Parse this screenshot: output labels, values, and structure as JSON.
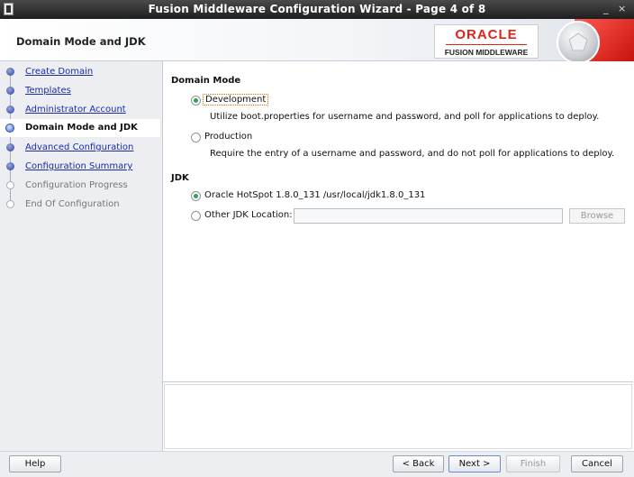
{
  "window": {
    "title": "Fusion Middleware Configuration Wizard - Page 4 of 8",
    "minimize_glyph": "_",
    "close_glyph": "×"
  },
  "header": {
    "step_title": "Domain Mode and JDK",
    "oracle_word": "ORACLE",
    "oracle_sub": "FUSION MIDDLEWARE"
  },
  "steps": [
    {
      "label": "Create Domain",
      "state": "done"
    },
    {
      "label": "Templates",
      "state": "done"
    },
    {
      "label": "Administrator Account",
      "state": "done"
    },
    {
      "label": "Domain Mode and JDK",
      "state": "current"
    },
    {
      "label": "Advanced Configuration",
      "state": "done"
    },
    {
      "label": "Configuration Summary",
      "state": "done"
    },
    {
      "label": "Configuration Progress",
      "state": "todo"
    },
    {
      "label": "End Of Configuration",
      "state": "todo"
    }
  ],
  "domain_mode": {
    "heading": "Domain Mode",
    "development": {
      "label": "Development",
      "description": "Utilize boot.properties for username and password, and poll for applications to deploy.",
      "selected": true
    },
    "production": {
      "label": "Production",
      "description": "Require the entry of a username and password, and do not poll for applications to deploy.",
      "selected": false
    }
  },
  "jdk": {
    "heading": "JDK",
    "oracle_hotspot": {
      "label": "Oracle HotSpot 1.8.0_131 /usr/local/jdk1.8.0_131",
      "selected": true
    },
    "other": {
      "label": "Other JDK Location:",
      "value": "",
      "selected": false
    },
    "browse_label": "Browse"
  },
  "footer": {
    "help": "Help",
    "back": "< Back",
    "next": "Next >",
    "finish": "Finish",
    "cancel": "Cancel"
  }
}
